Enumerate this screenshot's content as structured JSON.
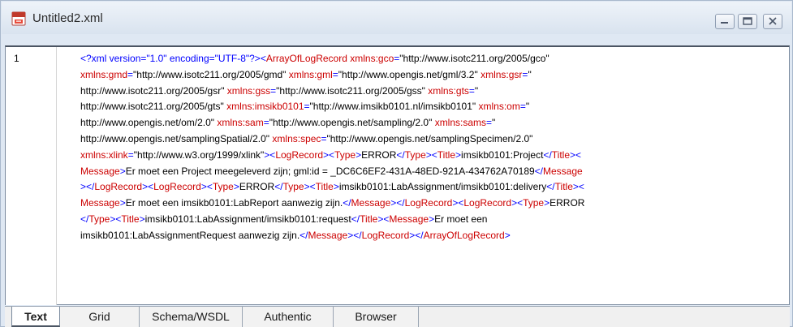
{
  "window": {
    "title": "Untitled2.xml",
    "doc_icon": "xml-document-icon",
    "buttons": [
      "minimize-icon",
      "restore-icon",
      "close-icon"
    ]
  },
  "editor": {
    "line_number": "1",
    "lines": [
      [
        {
          "t": "pi",
          "v": "<?xml version=\"1.0\" encoding=\"UTF-8\"?>"
        },
        {
          "t": "punct",
          "v": "<"
        },
        {
          "t": "tag",
          "v": "ArrayOfLogRecord"
        },
        {
          "t": "text",
          "v": " "
        },
        {
          "t": "attr",
          "v": "xmlns:gco"
        },
        {
          "t": "punct",
          "v": "="
        },
        {
          "t": "val",
          "v": "\"http://www.isotc211.org/2005/gco\""
        }
      ],
      [
        {
          "t": "attr",
          "v": "xmlns:gmd"
        },
        {
          "t": "punct",
          "v": "="
        },
        {
          "t": "val",
          "v": "\"http://www.isotc211.org/2005/gmd\" "
        },
        {
          "t": "attr",
          "v": "xmlns:gml"
        },
        {
          "t": "punct",
          "v": "="
        },
        {
          "t": "val",
          "v": "\"http://www.opengis.net/gml/3.2\" "
        },
        {
          "t": "attr",
          "v": "xmlns:gsr"
        },
        {
          "t": "punct",
          "v": "="
        },
        {
          "t": "val",
          "v": "\""
        }
      ],
      [
        {
          "t": "val",
          "v": "http://www.isotc211.org/2005/gsr\" "
        },
        {
          "t": "attr",
          "v": "xmlns:gss"
        },
        {
          "t": "punct",
          "v": "="
        },
        {
          "t": "val",
          "v": "\"http://www.isotc211.org/2005/gss\" "
        },
        {
          "t": "attr",
          "v": "xmlns:gts"
        },
        {
          "t": "punct",
          "v": "="
        },
        {
          "t": "val",
          "v": "\""
        }
      ],
      [
        {
          "t": "val",
          "v": "http://www.isotc211.org/2005/gts\" "
        },
        {
          "t": "attr",
          "v": "xmlns:imsikb0101"
        },
        {
          "t": "punct",
          "v": "="
        },
        {
          "t": "val",
          "v": "\"http://www.imsikb0101.nl/imsikb0101\" "
        },
        {
          "t": "attr",
          "v": "xmlns:om"
        },
        {
          "t": "punct",
          "v": "="
        },
        {
          "t": "val",
          "v": "\""
        }
      ],
      [
        {
          "t": "val",
          "v": "http://www.opengis.net/om/2.0\" "
        },
        {
          "t": "attr",
          "v": "xmlns:sam"
        },
        {
          "t": "punct",
          "v": "="
        },
        {
          "t": "val",
          "v": "\"http://www.opengis.net/sampling/2.0\" "
        },
        {
          "t": "attr",
          "v": "xmlns:sams"
        },
        {
          "t": "punct",
          "v": "="
        },
        {
          "t": "val",
          "v": "\""
        }
      ],
      [
        {
          "t": "val",
          "v": "http://www.opengis.net/samplingSpatial/2.0\" "
        },
        {
          "t": "attr",
          "v": "xmlns:spec"
        },
        {
          "t": "punct",
          "v": "="
        },
        {
          "t": "val",
          "v": "\"http://www.opengis.net/samplingSpecimen/2.0\""
        }
      ],
      [
        {
          "t": "attr",
          "v": "xmlns:xlink"
        },
        {
          "t": "punct",
          "v": "="
        },
        {
          "t": "val",
          "v": "\"http://www.w3.org/1999/xlink\""
        },
        {
          "t": "punct",
          "v": "><"
        },
        {
          "t": "tag",
          "v": "LogRecord"
        },
        {
          "t": "punct",
          "v": "><"
        },
        {
          "t": "tag",
          "v": "Type"
        },
        {
          "t": "punct",
          "v": ">"
        },
        {
          "t": "text",
          "v": "ERROR"
        },
        {
          "t": "punct",
          "v": "</"
        },
        {
          "t": "tag",
          "v": "Type"
        },
        {
          "t": "punct",
          "v": "><"
        },
        {
          "t": "tag",
          "v": "Title"
        },
        {
          "t": "punct",
          "v": ">"
        },
        {
          "t": "text",
          "v": "imsikb0101:Project"
        },
        {
          "t": "punct",
          "v": "</"
        },
        {
          "t": "tag",
          "v": "Title"
        },
        {
          "t": "punct",
          "v": "><"
        }
      ],
      [
        {
          "t": "tag",
          "v": "Message"
        },
        {
          "t": "punct",
          "v": ">"
        },
        {
          "t": "text",
          "v": "Er moet een Project meegeleverd zijn; gml:id = _DC6C6EF2-431A-48ED-921A-434762A70189"
        },
        {
          "t": "punct",
          "v": "</"
        },
        {
          "t": "tag",
          "v": "Message"
        }
      ],
      [
        {
          "t": "punct",
          "v": "></"
        },
        {
          "t": "tag",
          "v": "LogRecord"
        },
        {
          "t": "punct",
          "v": "><"
        },
        {
          "t": "tag",
          "v": "LogRecord"
        },
        {
          "t": "punct",
          "v": "><"
        },
        {
          "t": "tag",
          "v": "Type"
        },
        {
          "t": "punct",
          "v": ">"
        },
        {
          "t": "text",
          "v": "ERROR"
        },
        {
          "t": "punct",
          "v": "</"
        },
        {
          "t": "tag",
          "v": "Type"
        },
        {
          "t": "punct",
          "v": "><"
        },
        {
          "t": "tag",
          "v": "Title"
        },
        {
          "t": "punct",
          "v": ">"
        },
        {
          "t": "text",
          "v": "imsikb0101:LabAssignment/imsikb0101:delivery"
        },
        {
          "t": "punct",
          "v": "</"
        },
        {
          "t": "tag",
          "v": "Title"
        },
        {
          "t": "punct",
          "v": "><"
        }
      ],
      [
        {
          "t": "tag",
          "v": "Message"
        },
        {
          "t": "punct",
          "v": ">"
        },
        {
          "t": "text",
          "v": "Er moet een imsikb0101:LabReport aanwezig zijn."
        },
        {
          "t": "punct",
          "v": "</"
        },
        {
          "t": "tag",
          "v": "Message"
        },
        {
          "t": "punct",
          "v": "></"
        },
        {
          "t": "tag",
          "v": "LogRecord"
        },
        {
          "t": "punct",
          "v": "><"
        },
        {
          "t": "tag",
          "v": "LogRecord"
        },
        {
          "t": "punct",
          "v": "><"
        },
        {
          "t": "tag",
          "v": "Type"
        },
        {
          "t": "punct",
          "v": ">"
        },
        {
          "t": "text",
          "v": "ERROR"
        }
      ],
      [
        {
          "t": "punct",
          "v": "</"
        },
        {
          "t": "tag",
          "v": "Type"
        },
        {
          "t": "punct",
          "v": "><"
        },
        {
          "t": "tag",
          "v": "Title"
        },
        {
          "t": "punct",
          "v": ">"
        },
        {
          "t": "text",
          "v": "imsikb0101:LabAssignment/imsikb0101:request"
        },
        {
          "t": "punct",
          "v": "</"
        },
        {
          "t": "tag",
          "v": "Title"
        },
        {
          "t": "punct",
          "v": "><"
        },
        {
          "t": "tag",
          "v": "Message"
        },
        {
          "t": "punct",
          "v": ">"
        },
        {
          "t": "text",
          "v": "Er moet een"
        }
      ],
      [
        {
          "t": "text",
          "v": "imsikb0101:LabAssignmentRequest aanwezig zijn."
        },
        {
          "t": "punct",
          "v": "</"
        },
        {
          "t": "tag",
          "v": "Message"
        },
        {
          "t": "punct",
          "v": "></"
        },
        {
          "t": "tag",
          "v": "LogRecord"
        },
        {
          "t": "punct",
          "v": "></"
        },
        {
          "t": "tag",
          "v": "ArrayOfLogRecord"
        },
        {
          "t": "punct",
          "v": ">"
        }
      ]
    ]
  },
  "tabs": [
    {
      "label": "Text",
      "active": true
    },
    {
      "label": "Grid",
      "active": false
    },
    {
      "label": "Schema/WSDL",
      "active": false
    },
    {
      "label": "Authentic",
      "active": false
    },
    {
      "label": "Browser",
      "active": false
    }
  ]
}
